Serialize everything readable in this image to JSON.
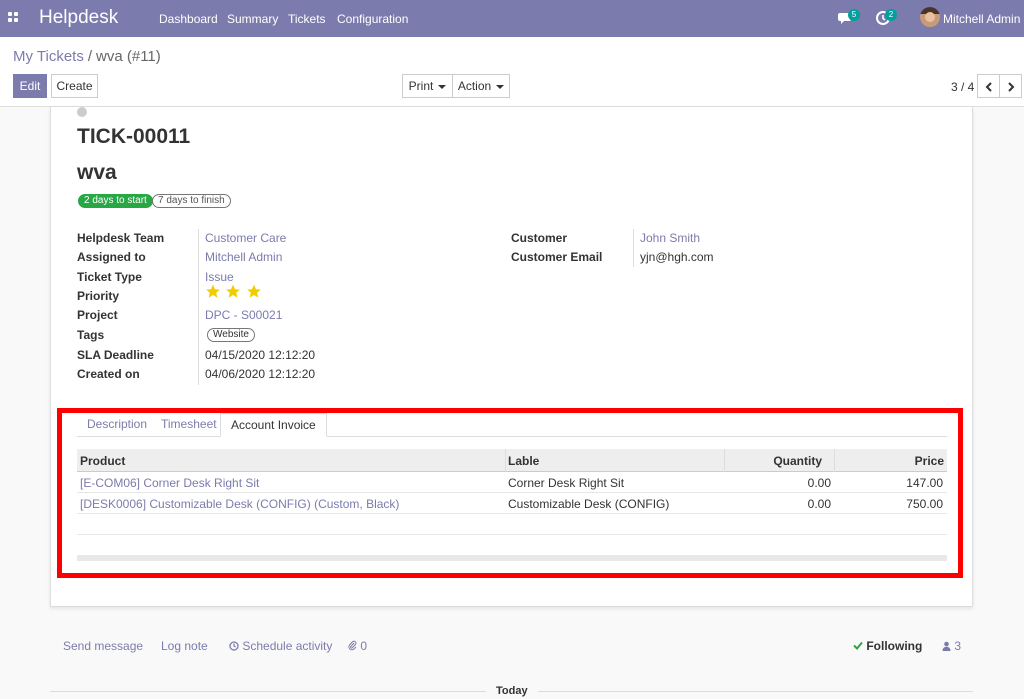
{
  "navbar": {
    "brand": "Helpdesk",
    "menu": [
      "Dashboard",
      "Summary",
      "Tickets",
      "Configuration"
    ],
    "messages_count": "5",
    "activities_count": "2",
    "user_name": "Mitchell Admin"
  },
  "control_panel": {
    "breadcrumb_parent": "My Tickets",
    "breadcrumb_separator": "/",
    "breadcrumb_current": "wva (#11)",
    "edit_label": "Edit",
    "create_label": "Create",
    "print_label": "Print",
    "action_label": "Action",
    "pager_value": "3 / 4"
  },
  "ticket": {
    "reference": "TICK-00011",
    "name": "wva",
    "badge_start": "2 days to start",
    "badge_finish": "7 days to finish",
    "fields_left": [
      {
        "label": "Helpdesk Team",
        "value": "Customer Care"
      },
      {
        "label": "Assigned to",
        "value": "Mitchell Admin"
      },
      {
        "label": "Ticket Type",
        "value": "Issue"
      },
      {
        "label": "Priority",
        "value": ""
      },
      {
        "label": "Project",
        "value": "DPC - S00021"
      },
      {
        "label": "Tags",
        "value": "Website"
      },
      {
        "label": "SLA Deadline",
        "value": "04/15/2020 12:12:20"
      },
      {
        "label": "Created on",
        "value": "04/06/2020 12:12:20"
      }
    ],
    "priority_stars": 3,
    "fields_right": [
      {
        "label": "Customer",
        "value": "John Smith"
      },
      {
        "label": "Customer Email",
        "value": "yjn@hgh.com"
      }
    ]
  },
  "notebook": {
    "tabs": [
      "Description",
      "Timesheet",
      "Account Invoice"
    ],
    "active_tab": "Account Invoice",
    "columns": [
      "Product",
      "Lable",
      "Quantity",
      "Price"
    ],
    "rows": [
      {
        "product": "[E-COM06] Corner Desk Right Sit",
        "label": "Corner Desk Right Sit",
        "quantity": "0.00",
        "price": "147.00"
      },
      {
        "product": "[DESK0006] Customizable Desk (CONFIG) (Custom, Black)",
        "label": "Customizable Desk (CONFIG)",
        "quantity": "0.00",
        "price": "750.00"
      }
    ]
  },
  "chatter": {
    "send_message": "Send message",
    "log_note": "Log note",
    "schedule_activity": "Schedule activity",
    "attachments": "0",
    "following": "Following",
    "followers": "3",
    "today": "Today"
  },
  "colors": {
    "brand": "#7c7bad",
    "highlight": "#ff0000",
    "success": "#28a745",
    "star": "#f3cc00"
  }
}
